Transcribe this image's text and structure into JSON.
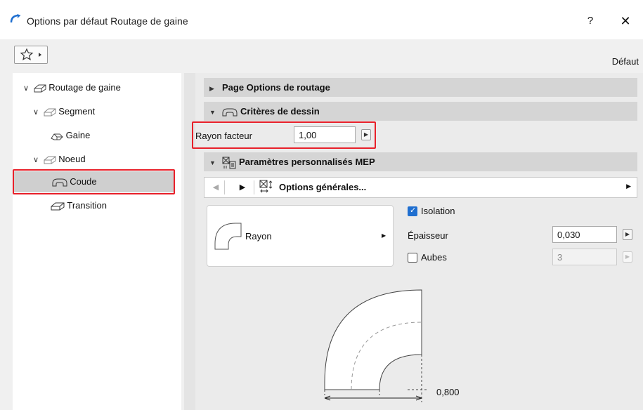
{
  "window": {
    "title": "Options par défaut Routage de gaine",
    "help": "?",
    "close": "✕"
  },
  "toolbar": {
    "favorites_icon": "star-icon",
    "preset_label": "Défaut"
  },
  "tree": {
    "items": [
      {
        "label": "Routage de gaine",
        "expanded": true
      },
      {
        "label": "Segment",
        "expanded": true
      },
      {
        "label": "Gaine"
      },
      {
        "label": "Noeud",
        "expanded": true
      },
      {
        "label": "Coude",
        "selected": true
      },
      {
        "label": "Transition"
      }
    ]
  },
  "sections": {
    "routing_options": "Page Options de routage",
    "drawing_criteria": "Critères de dessin",
    "mep_params": "Paramètres personnalisés MEP"
  },
  "drawing_criteria": {
    "radius_factor_label": "Rayon facteur",
    "radius_factor_value": "1,00"
  },
  "mep": {
    "page_label": "Options générales...",
    "shape_label": "Rayon",
    "insulation_label": "Isolation",
    "insulation_checked": true,
    "thickness_label": "Épaisseur",
    "thickness_value": "0,030",
    "vanes_label": "Aubes",
    "vanes_checked": false,
    "vanes_value": "3"
  },
  "preview": {
    "dimension_label": "0,800"
  },
  "colors": {
    "highlight_frame": "#e8202a",
    "checkbox_accent": "#1f6fd0"
  }
}
